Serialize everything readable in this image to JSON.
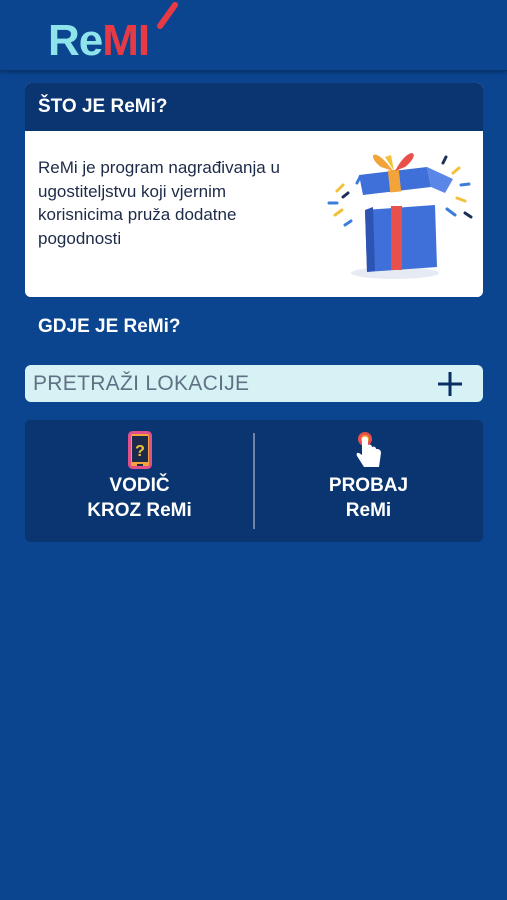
{
  "app": {
    "logo_text": "ReMi"
  },
  "intro_card": {
    "title": "ŠTO JE ReMi?",
    "description": "ReMi je program nagrađivanja u ugostiteljstvu koji vjernim korisnicima pruža dodatne pogodnosti"
  },
  "where_section": {
    "title": "GDJE JE ReMi?"
  },
  "search": {
    "label": "PRETRAŽI LOKACIJE"
  },
  "actions": {
    "guide": {
      "line1": "VODIČ",
      "line2": "KROZ ReMi",
      "icon": "phone-question-icon"
    },
    "try": {
      "line1": "PROBAJ",
      "line2": "ReMi",
      "icon": "tap-hand-icon"
    }
  },
  "colors": {
    "background": "#0b4590",
    "card_header": "#0a3570",
    "search_bg": "#d7f2f4",
    "accent_red": "#e83a45",
    "logo_cyan": "#8fe3ea"
  }
}
